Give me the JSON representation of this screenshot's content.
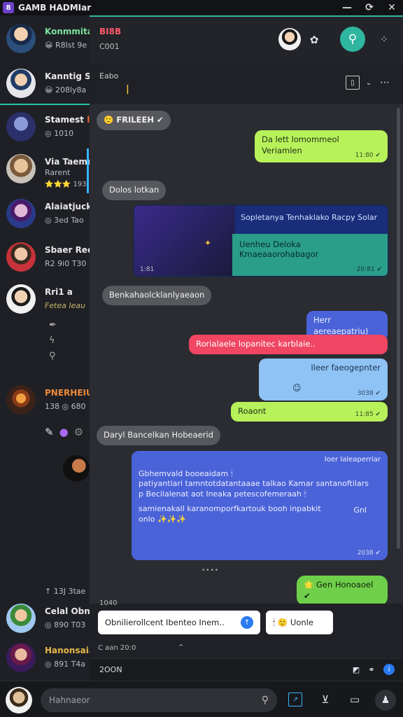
{
  "window": {
    "title": "GAMB HADMIar"
  },
  "sidebar": {
    "contacts": [
      {
        "name": "Konmmita",
        "sub": "😀 R8Ist 9e",
        "name_color": "#7ee0a0"
      },
      {
        "name": "Kanntig Sa",
        "sub": "😀 208ly8a",
        "name_color": "#f0f0f0"
      },
      {
        "name": "Stamest loe",
        "sub": "◎ 1010",
        "name_color": "#f0f0f0"
      },
      {
        "name": "Via Taemm",
        "sub": "Rarent",
        "sub2": "⭐⭐⭐ 193",
        "name_color": "#f0f0f0"
      },
      {
        "name": "Alaiatjuck",
        "sub": "◎ 3ed Tao",
        "name_color": "#f0f0f0"
      },
      {
        "name": "Sbaer Ree",
        "sub": "R2 9i0 T30",
        "name_color": "#f0f0f0"
      },
      {
        "name": "Rri1 a",
        "sub": "Fetea leau",
        "name_color": "#f0f0f0"
      },
      {
        "name": "PNERHEIUN",
        "sub": "138 ◎ 680",
        "name_color": "#f08a3a"
      },
      {
        "name": "Celal Obnn",
        "sub": "◎ 890 T03",
        "name_color": "#f0f0f0"
      },
      {
        "name": "Hanonsaia",
        "sub": "◎ 891 T4a",
        "name_color": "#e8b84a"
      }
    ],
    "note": "↑ 13J 3tae"
  },
  "header": {
    "title": "BI8B",
    "subtitle": "C001"
  },
  "subheader": {
    "title": "Eabo",
    "cursor": "|"
  },
  "messages": [
    {
      "id": "m1",
      "dir": "in",
      "text": "🙂 FRILEEH ✔",
      "time": ""
    },
    {
      "id": "m2",
      "dir": "out",
      "text": "Da lett lomommeol Veriamlen",
      "time": "11:80 ✔"
    },
    {
      "id": "m3",
      "dir": "in",
      "text": "Dolos lotkan",
      "time": ""
    },
    {
      "id": "m4",
      "dir": "out",
      "text": "Sopletanya Tenhaklako Racpy Solar",
      "time": "1:81"
    },
    {
      "id": "m5",
      "dir": "out",
      "text": "Uenheu Deloka Kmaeaaorohabagor",
      "time": "20:81 ✔"
    },
    {
      "id": "m6",
      "dir": "in",
      "text": "Benkahaolcklanlyaeaon",
      "time": ""
    },
    {
      "id": "m7",
      "dir": "out",
      "text": "Herr aereaepatriu)",
      "time": ""
    },
    {
      "id": "m8",
      "dir": "out",
      "text": "Rorialaele lopanitec karblaie..",
      "time": ""
    },
    {
      "id": "m9",
      "dir": "out",
      "text": "Ileer faeogepnter",
      "time": "3038 ✔"
    },
    {
      "id": "m10",
      "dir": "out",
      "text": "Roaont",
      "time": "11:85 ✔"
    },
    {
      "id": "m11",
      "dir": "in",
      "text": "Daryl Bancelkan Hobeaerid",
      "time": ""
    },
    {
      "id": "m12",
      "dir": "out",
      "head": "Ioer Ialeaperriar",
      "lines": [
        "Gbhemvald booeaidam 🕯",
        "patiyantiari tamntotdatantaaae talkao Kamar santanoftilars",
        "p Becilalenat aot Ineaka petescofemeraah 🕯",
        "samienakall karanomporfkartouk booh inpabkit",
        "onlo ✨✨✨"
      ],
      "side": "Gnl",
      "time": "2038 ✔"
    },
    {
      "id": "m13",
      "dir": "out",
      "text": "🌟 Gen Honoaoel ✔",
      "time": ""
    }
  ],
  "chat": {
    "date_divider": "••••",
    "left_note": "1040"
  },
  "composer": {
    "input1": "Obnilierollcent Ibenteo Inem..",
    "input2": "🕯 🙂 Uonle",
    "status_left": "C aan 20:0",
    "status_right": "⌃"
  },
  "statusbar": {
    "left": "2OON"
  },
  "bottombar": {
    "search_placeholder": "Hahnaeor"
  },
  "colors": {
    "accent": "#2fb6a0",
    "blue": "#4a63d8",
    "green": "#b8f25a",
    "red": "#f04563"
  }
}
